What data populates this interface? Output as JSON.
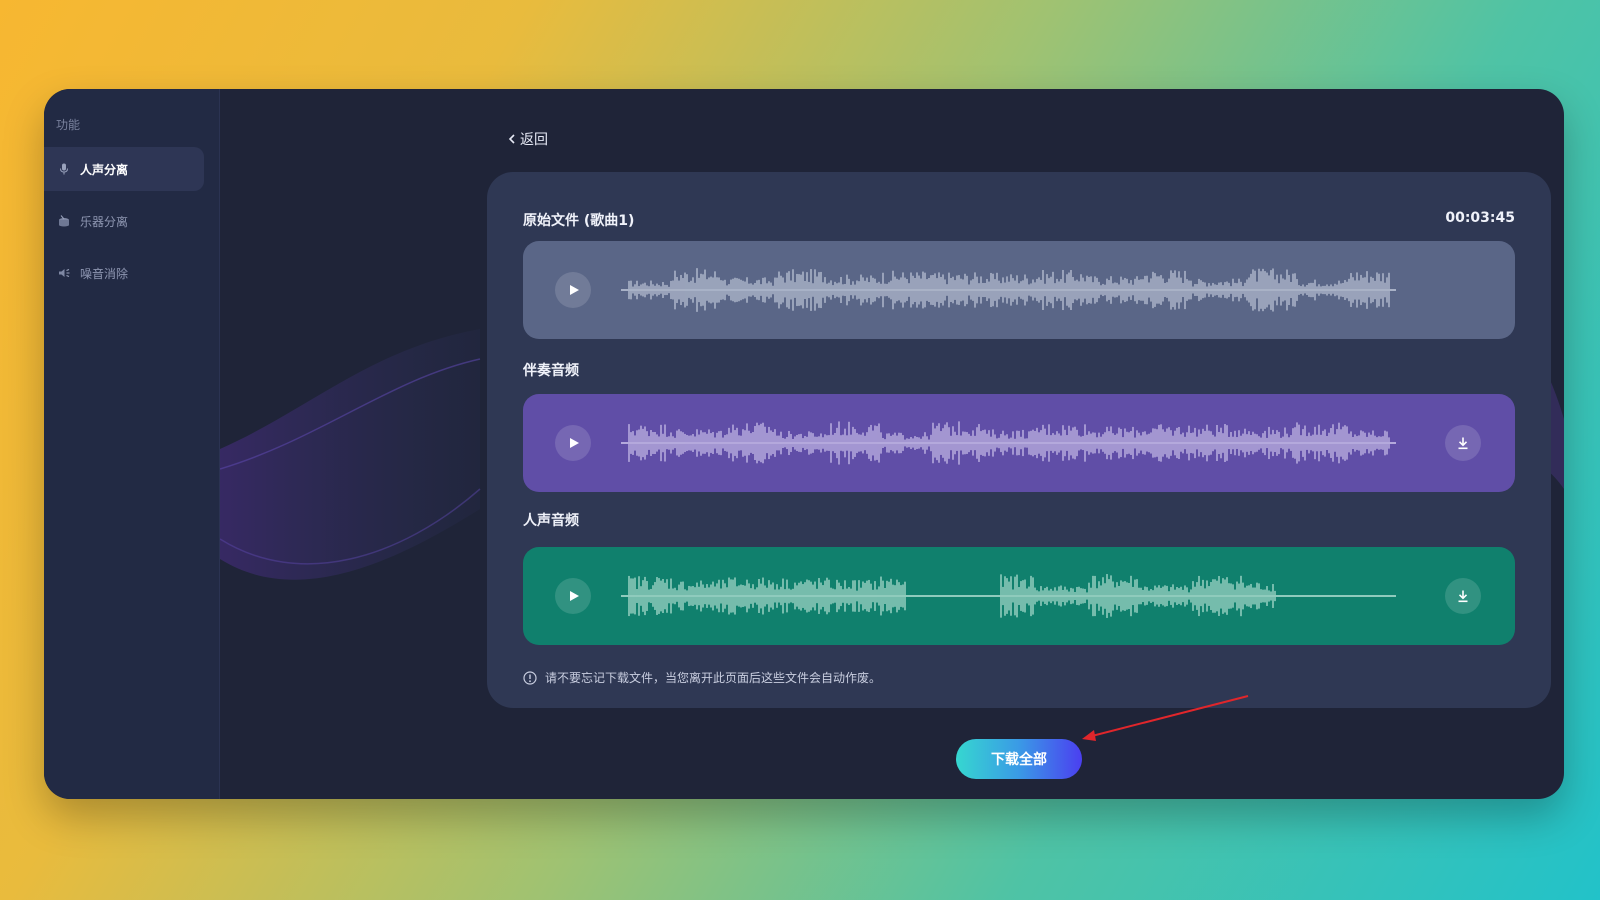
{
  "sidebar": {
    "heading": "功能",
    "items": [
      {
        "label": "人声分离",
        "icon": "microphone-icon",
        "active": true
      },
      {
        "label": "乐器分离",
        "icon": "drum-icon",
        "active": false
      },
      {
        "label": "噪音消除",
        "icon": "speaker-icon",
        "active": false
      }
    ]
  },
  "header": {
    "back_label": "返回",
    "back_icon": "chevron-left-icon"
  },
  "tracks": {
    "original": {
      "label": "原始文件 (歌曲1)",
      "duration": "00:03:45",
      "color": "#5a6687",
      "wave_color": "#a9b2c7"
    },
    "accompaniment": {
      "label": "伴奏音频",
      "color": "#604ea7",
      "wave_color": "#b4a9dc"
    },
    "vocal": {
      "label": "人声音频",
      "color": "#10806d",
      "wave_color": "#8fcbbd"
    }
  },
  "notice": {
    "icon": "info-icon",
    "text": "请不要忘记下载文件，当您离开此页面后这些文件会自动作废。"
  },
  "actions": {
    "download_all_label": "下载全部"
  },
  "colors": {
    "window_bg": "#1f2438",
    "sidebar_bg": "#222a44",
    "card_bg": "#2f3854",
    "annotation_arrow": "#e0262b"
  }
}
